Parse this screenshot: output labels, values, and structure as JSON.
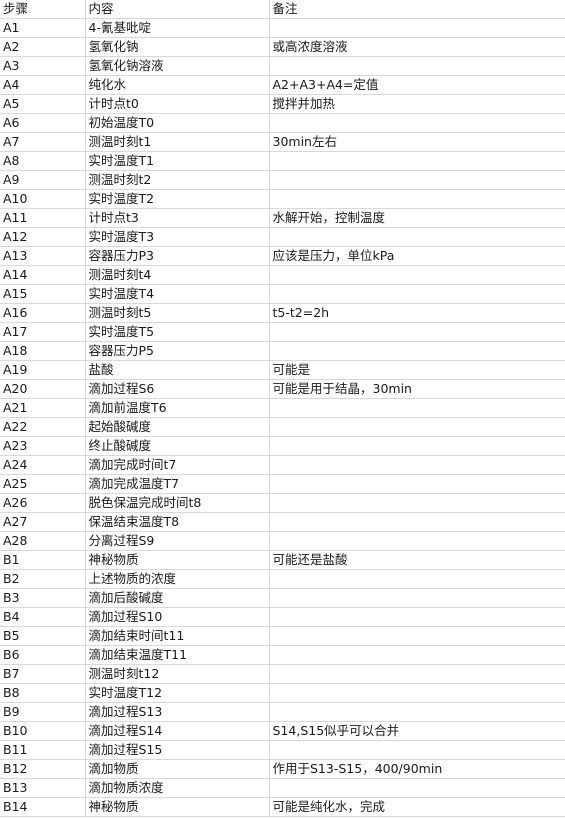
{
  "header": {
    "step": "步骤",
    "content": "内容",
    "note": "备注"
  },
  "rows": [
    {
      "step": "A1",
      "content": "4-氰基吡啶",
      "note": ""
    },
    {
      "step": "A2",
      "content": "氢氧化钠",
      "note": "或高浓度溶液"
    },
    {
      "step": "A3",
      "content": "氢氧化钠溶液",
      "note": ""
    },
    {
      "step": "A4",
      "content": "纯化水",
      "note": "A2+A3+A4=定值"
    },
    {
      "step": "A5",
      "content": "计时点t0",
      "note": "搅拌并加热"
    },
    {
      "step": "A6",
      "content": "初始温度T0",
      "note": ""
    },
    {
      "step": "A7",
      "content": "测温时刻t1",
      "note": "30min左右"
    },
    {
      "step": "A8",
      "content": "实时温度T1",
      "note": ""
    },
    {
      "step": "A9",
      "content": "测温时刻t2",
      "note": ""
    },
    {
      "step": "A10",
      "content": "实时温度T2",
      "note": ""
    },
    {
      "step": "A11",
      "content": "计时点t3",
      "note": "水解开始，控制温度"
    },
    {
      "step": "A12",
      "content": "实时温度T3",
      "note": ""
    },
    {
      "step": "A13",
      "content": "容器压力P3",
      "note": "应该是压力，单位kPa"
    },
    {
      "step": "A14",
      "content": "测温时刻t4",
      "note": ""
    },
    {
      "step": "A15",
      "content": "实时温度T4",
      "note": ""
    },
    {
      "step": "A16",
      "content": "测温时刻t5",
      "note": "t5-t2=2h"
    },
    {
      "step": "A17",
      "content": "实时温度T5",
      "note": ""
    },
    {
      "step": "A18",
      "content": "容器压力P5",
      "note": ""
    },
    {
      "step": "A19",
      "content": "盐酸",
      "note": "可能是"
    },
    {
      "step": "A20",
      "content": "滴加过程S6",
      "note": "可能是用于结晶，30min"
    },
    {
      "step": "A21",
      "content": "滴加前温度T6",
      "note": ""
    },
    {
      "step": "A22",
      "content": "起始酸碱度",
      "note": ""
    },
    {
      "step": "A23",
      "content": "终止酸碱度",
      "note": ""
    },
    {
      "step": "A24",
      "content": "滴加完成时间t7",
      "note": ""
    },
    {
      "step": "A25",
      "content": "滴加完成温度T7",
      "note": ""
    },
    {
      "step": "A26",
      "content": "脱色保温完成时间t8",
      "note": ""
    },
    {
      "step": "A27",
      "content": "保温结束温度T8",
      "note": ""
    },
    {
      "step": "A28",
      "content": "分离过程S9",
      "note": ""
    },
    {
      "step": "B1",
      "content": "神秘物质",
      "note": "可能还是盐酸"
    },
    {
      "step": "B2",
      "content": "上述物质的浓度",
      "note": ""
    },
    {
      "step": "B3",
      "content": "滴加后酸碱度",
      "note": ""
    },
    {
      "step": "B4",
      "content": "滴加过程S10",
      "note": ""
    },
    {
      "step": "B5",
      "content": "滴加结束时间t11",
      "note": ""
    },
    {
      "step": "B6",
      "content": "滴加结束温度T11",
      "note": ""
    },
    {
      "step": "B7",
      "content": "测温时刻t12",
      "note": ""
    },
    {
      "step": "B8",
      "content": "实时温度T12",
      "note": ""
    },
    {
      "step": "B9",
      "content": "滴加过程S13",
      "note": ""
    },
    {
      "step": "B10",
      "content": "滴加过程S14",
      "note": "S14,S15似乎可以合并"
    },
    {
      "step": "B11",
      "content": "滴加过程S15",
      "note": ""
    },
    {
      "step": "B12",
      "content": "滴加物质",
      "note": "作用于S13-S15，400/90min"
    },
    {
      "step": "B13",
      "content": "滴加物质浓度",
      "note": ""
    },
    {
      "step": "B14",
      "content": "神秘物质",
      "note": "可能是纯化水，完成"
    }
  ]
}
